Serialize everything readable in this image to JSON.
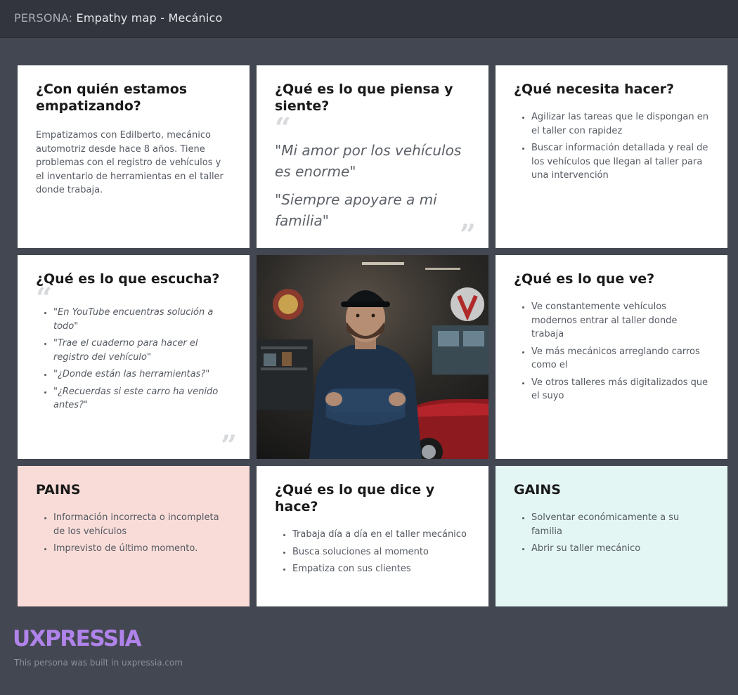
{
  "header": {
    "prefix": "PERSONA:",
    "title": "Empathy map - Mecánico"
  },
  "cards": {
    "with_who": {
      "title": "¿Con quién estamos empatizando?",
      "text": "Empatizamos con Edilberto, mecánico automotriz desde hace 8 años. Tiene problemas con el registro de vehículos y el inventario de herramientas en el taller donde trabaja."
    },
    "think_feel": {
      "title": "¿Qué es lo que piensa y siente?",
      "quotes": [
        "\"Mi amor por los vehículos es enorme\"",
        "\"Siempre apoyare a mi familia\""
      ]
    },
    "need_do": {
      "title": "¿Qué necesita hacer?",
      "items": [
        "Agilizar las tareas que le dispongan en el taller con rapidez",
        "Buscar información detallada y real de los vehículos que llegan al taller para una intervención"
      ]
    },
    "hear": {
      "title": "¿Qué es lo que escucha?",
      "items": [
        "\"En  YouTube encuentras solución a todo\"",
        "\"Trae el cuaderno para hacer el registro del vehículo\"",
        "\"¿Donde están las herramientas?\"",
        "\"¿Recuerdas si este carro ha venido antes?\""
      ]
    },
    "see": {
      "title": "¿Qué es lo que ve?",
      "items": [
        "Ve constantemente vehículos modernos entrar al taller donde trabaja",
        "Ve más mecánicos arreglando carros como el",
        "Ve otros talleres más digitalizados que el suyo"
      ]
    },
    "pains": {
      "title": "PAINS",
      "items": [
        "Información incorrecta o incompleta de los vehículos",
        "Imprevisto de último momento."
      ]
    },
    "say_do": {
      "title": "¿Qué es lo que dice y hace?",
      "items": [
        "Trabaja día a día en el taller mecánico",
        "Busca soluciones al momento",
        "Empatiza con sus clientes"
      ]
    },
    "gains": {
      "title": "GAINS",
      "items": [
        "Solventar económicamente a su familia",
        "Abrir su taller mecánico"
      ]
    }
  },
  "colors": {
    "background": "#434751",
    "pains_bg": "#f9dcd8",
    "gains_bg": "#e3f6f3",
    "logo": "#b083ea"
  },
  "footer": {
    "logo": "UXPRESSIA",
    "text": "This persona was built in uxpressia.com"
  }
}
